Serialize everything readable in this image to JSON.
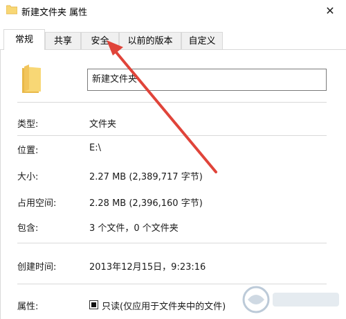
{
  "window": {
    "title": "新建文件夹 属性",
    "close_glyph": "✕"
  },
  "tabs": [
    {
      "label": "常规",
      "active": true
    },
    {
      "label": "共享",
      "active": false
    },
    {
      "label": "安全",
      "active": false
    },
    {
      "label": "以前的版本",
      "active": false
    },
    {
      "label": "自定义",
      "active": false
    }
  ],
  "general": {
    "folder_name": "新建文件夹",
    "type_label": "类型:",
    "type_value": "文件夹",
    "location_label": "位置:",
    "location_value": "E:\\",
    "size_label": "大小:",
    "size_value": "2.27 MB (2,389,717 字节)",
    "size_on_disk_label": "占用空间:",
    "size_on_disk_value": "2.28 MB (2,396,160 字节)",
    "contains_label": "包含:",
    "contains_value": "3 个文件，0 个文件夹",
    "created_label": "创建时间:",
    "created_value": "2013年12月15日，9:23:16",
    "attributes_label": "属性:",
    "readonly_label": "只读(仅应用于文件夹中的文件)",
    "readonly_checked": true
  },
  "icons": {
    "title_icon": "folder-icon",
    "large_icon": "folder-icon",
    "annotation": "red-arrow-annotation",
    "watermark": "xitongzhijia-watermark-logo"
  },
  "colors": {
    "folder_yellow": "#f8d775",
    "folder_shade": "#e9b949",
    "arrow_red": "#e0443a",
    "tab_border": "#d9d9d9",
    "input_border": "#7a7a7a"
  }
}
